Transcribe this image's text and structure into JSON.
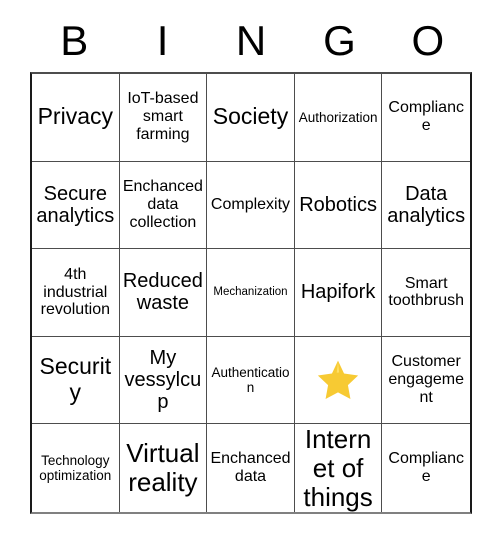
{
  "card": {
    "title": "BINGO",
    "header_letters": [
      "B",
      "I",
      "N",
      "G",
      "O"
    ],
    "rows": 5,
    "columns": 5,
    "colors": {
      "background": "#ffffff",
      "text": "#000000",
      "grid_line": "#4d4d4d",
      "outer_border": "#1a1a1a",
      "star_fill": "#f7ca33",
      "star_highlight": "#ffe066",
      "star_shadow": "#e0a92a"
    },
    "free_space": {
      "row": 4,
      "column": 4,
      "icon": "star-icon",
      "label": ""
    },
    "cells": [
      [
        {
          "text": "Privacy",
          "size": "lg"
        },
        {
          "text": "IoT-based smart farming",
          "size": "sm"
        },
        {
          "text": "Society",
          "size": "lg"
        },
        {
          "text": "Authorization",
          "size": "xs"
        },
        {
          "text": "Compliance",
          "size": "sm"
        }
      ],
      [
        {
          "text": "Secure analytics",
          "size": "md"
        },
        {
          "text": "Enchanced data collection",
          "size": "sm"
        },
        {
          "text": "Complexity",
          "size": "sm"
        },
        {
          "text": "Robotics",
          "size": "md"
        },
        {
          "text": "Data analytics",
          "size": "md"
        }
      ],
      [
        {
          "text": "4th industrial revolution",
          "size": "sm"
        },
        {
          "text": "Reduced waste",
          "size": "md"
        },
        {
          "text": "Mechanization",
          "size": "xxs"
        },
        {
          "text": "Hapifork",
          "size": "md"
        },
        {
          "text": "Smart toothbrush",
          "size": "sm"
        }
      ],
      [
        {
          "text": "Security",
          "size": "lg"
        },
        {
          "text": "My vessylcup",
          "size": "md"
        },
        {
          "text": "Authentication",
          "size": "xs"
        },
        {
          "text": "",
          "size": "md",
          "free": true
        },
        {
          "text": "Customer engagement",
          "size": "sm"
        }
      ],
      [
        {
          "text": "Technology optimization",
          "size": "xs"
        },
        {
          "text": "Virtual reality",
          "size": "xl"
        },
        {
          "text": "Enchanced data",
          "size": "sm"
        },
        {
          "text": "Internet of things",
          "size": "xl"
        },
        {
          "text": "Compliance",
          "size": "sm"
        }
      ]
    ]
  }
}
